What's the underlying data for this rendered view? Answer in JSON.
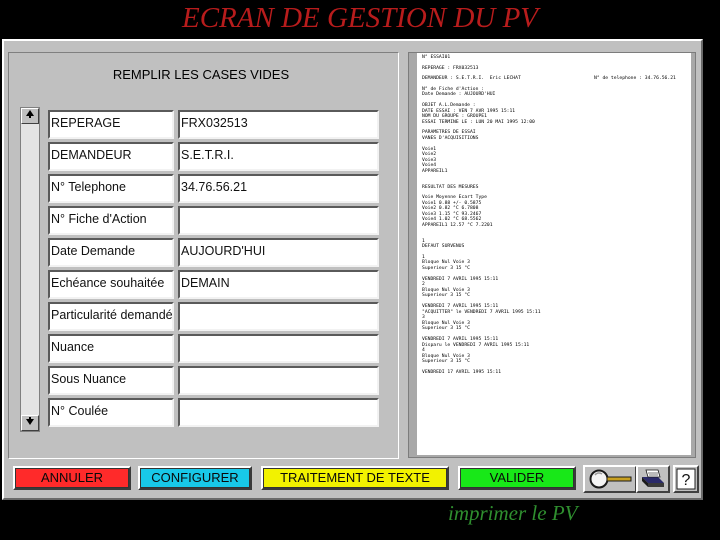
{
  "title": "ECRAN DE GESTION DU PV",
  "form": {
    "heading": "REMPLIR LES CASES VIDES",
    "rows": [
      {
        "label": "REPERAGE",
        "value": "FRX032513"
      },
      {
        "label": "DEMANDEUR",
        "value": "S.E.T.R.I."
      },
      {
        "label": "N° Telephone",
        "value": "34.76.56.21"
      },
      {
        "label": "N° Fiche d'Action",
        "value": ""
      },
      {
        "label": "Date Demande",
        "value": "AUJOURD'HUI"
      },
      {
        "label": "Echéance souhaitée",
        "value": "DEMAIN"
      },
      {
        "label": "Particularité demandée",
        "value": ""
      },
      {
        "label": "Nuance",
        "value": ""
      },
      {
        "label": "Sous Nuance",
        "value": ""
      },
      {
        "label": "N° Coulée",
        "value": ""
      }
    ]
  },
  "pv": {
    "l1": "N° ESSAI01",
    "l2": "REPERAGE : FRX032513",
    "l3": "DEMANDEUR : S.E.T.R.I.  Eric LECHAT",
    "l3r": "N° de telephone : 34.76.56.21",
    "l4": "N° de Fiche d'Action :",
    "l5": "Date Demande : AUJOURD'HUI",
    "l6": "OBJET A.L.Demande :",
    "l7": "DATE ESSAI : VEN 7 AVR 1995 15:11",
    "l8": "NOM DU GROUPE : GROUPE1",
    "l9": "ESSAI TERMINE LE : LUN 20 MAI 1995 12:00",
    "l10": "PARAMETRES DE ESSAI",
    "l11": "VANES D'ACQUISITIONS",
    "l12": "Voie1",
    "l13": "Voie2",
    "l14": "Voie3",
    "l15": "Voie4",
    "l16": "APPAREIL1",
    "l17": "RESULTAT DES MESURES",
    "l18": "Voie Moyenne Ecart Type",
    "l19": "Voie1 0.88 +/- 0.5875",
    "l20": "Voie2 0.82 °C 6.7808",
    "l21": "Voie3 1.15 °C 93.2467",
    "l22": "Voie4 1.02 °C 68.5562",
    "l23": "APPAREIL1 12.57 °C 7.2201",
    "l24": "1",
    "l25": "DEFAUT SURVENUS",
    "l26": "1",
    "l27": "Bloque Nul Voie 3",
    "l28": "Superieur 3 15 °C",
    "l29": "VENDREDI 7 AVRIL 1995 15:11",
    "l30": "2",
    "l31": "Bloque Nul Voie 3",
    "l32": "Superieur 3 15 °C",
    "l33": "VENDREDI 7 AVRIL 1995 15:11",
    "l34": "\"ACQUITTER\" le VENDREDI 7 AVRIL 1995 15:11",
    "l35": "3",
    "l36": "Bloque Nul Voie 3",
    "l37": "Superieur 3 15 °C",
    "l38": "VENDREDI 7 AVRIL 1995 15:11",
    "l39": "Disparu le VENDREDI 7 AVRIL 1995 15:11",
    "l40": "4",
    "l41": "Bloque Nul Voie 3",
    "l42": "Superieur 3 15 °C",
    "l43": "VENDREDI 17 AVRIL 1995 15:11"
  },
  "toolbar": {
    "annuler": "ANNULER",
    "configurer": "CONFIGURER",
    "traitement": "TRAITEMENT DE TEXTE",
    "valider": "VALIDER",
    "help": "?"
  },
  "colors": {
    "annuler": "#ff2a2a",
    "configurer": "#18c8e8",
    "traitement": "#f2f200",
    "valider": "#18e818"
  },
  "icons": [
    "scroll-up-icon",
    "scroll-down-icon",
    "magnifier-icon",
    "print-icon",
    "help-icon"
  ],
  "caption": "imprimer le PV"
}
